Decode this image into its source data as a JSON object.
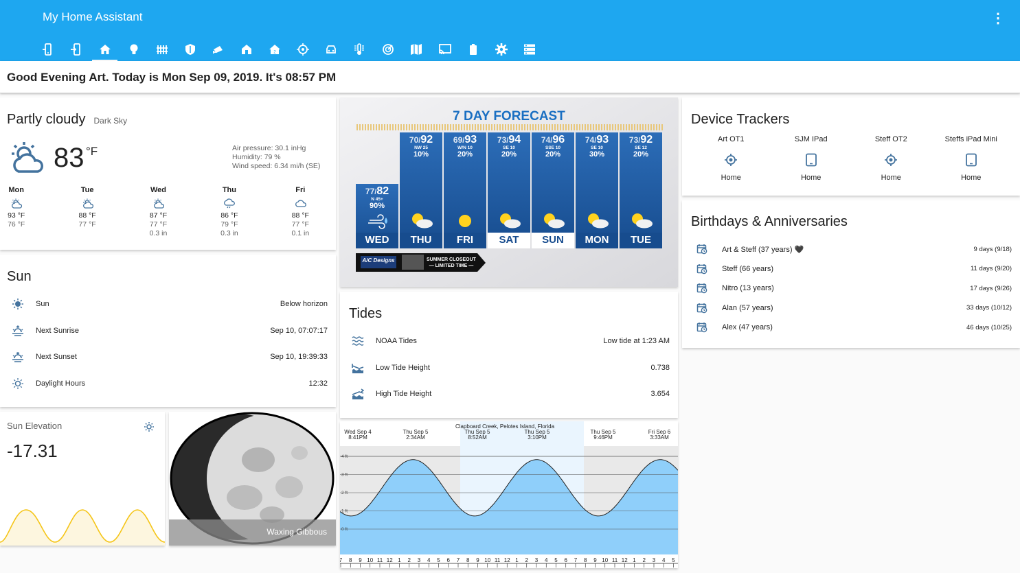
{
  "header": {
    "title": "My Home Assistant",
    "menu_icon": "dots-vertical-icon",
    "tabs": [
      "phone-icon",
      "phone-enter-icon",
      "home-icon",
      "bulb-icon",
      "fence-icon",
      "shield-icon",
      "cctv-icon",
      "home-modern-icon",
      "home-floor-icon",
      "crosshair-icon",
      "car-icon",
      "thermometer-icon",
      "radar-icon",
      "map-icon",
      "cast-icon",
      "battery-icon",
      "settings-icon",
      "server-icon"
    ],
    "active_tab": 2
  },
  "greeting": "Good Evening Art. Today is Mon Sep 09, 2019. It's 08:57 PM",
  "weather": {
    "condition": "Partly cloudy",
    "source": "Dark Sky",
    "temp": "83",
    "unit": "°F",
    "pressure": "Air pressure: 30.1 inHg",
    "humidity": "Humidity: 79 %",
    "wind": "Wind speed: 6.34 mi/h (SE)",
    "forecast": [
      {
        "day": "Mon",
        "icon": "partly-cloudy-icon",
        "high": "93 °F",
        "low": "76 °F",
        "precip": ""
      },
      {
        "day": "Tue",
        "icon": "partly-cloudy-icon",
        "high": "88 °F",
        "low": "77 °F",
        "precip": ""
      },
      {
        "day": "Wed",
        "icon": "partly-cloudy-icon",
        "high": "87 °F",
        "low": "77 °F",
        "precip": "0.3 in"
      },
      {
        "day": "Thu",
        "icon": "rain-icon",
        "high": "86 °F",
        "low": "79 °F",
        "precip": "0.3 in"
      },
      {
        "day": "Fri",
        "icon": "cloudy-icon",
        "high": "88 °F",
        "low": "77 °F",
        "precip": "0.1 in"
      }
    ]
  },
  "sun": {
    "title": "Sun",
    "rows": [
      {
        "icon": "sun-icon",
        "label": "Sun",
        "value": "Below horizon"
      },
      {
        "icon": "sunrise-icon",
        "label": "Next Sunrise",
        "value": "Sep 10, 07:07:17"
      },
      {
        "icon": "sunset-icon",
        "label": "Next Sunset",
        "value": "Sep 10, 19:39:33"
      },
      {
        "icon": "sun-outline-icon",
        "label": "Daylight Hours",
        "value": "12:32"
      }
    ]
  },
  "sun_elevation": {
    "title": "Sun Elevation",
    "value": "-17.31",
    "color": "#f5c518"
  },
  "moon": {
    "phase": "Waxing Gibbous"
  },
  "forecast_image": {
    "title": "7 DAY FORECAST",
    "sponsor": "A/C Designs",
    "promo_line1": "SUMMER CLOSEOUT",
    "promo_line2": "— LIMITED TIME —",
    "days": [
      {
        "day": "WED",
        "lo": "77",
        "hi": "82",
        "wind": "N 45+",
        "pop": "90%",
        "highlight": false
      },
      {
        "day": "THU",
        "lo": "70",
        "hi": "92",
        "wind": "NW 25",
        "pop": "10%",
        "highlight": false
      },
      {
        "day": "FRI",
        "lo": "69",
        "hi": "93",
        "wind": "W/N 10",
        "pop": "20%",
        "highlight": false
      },
      {
        "day": "SAT",
        "lo": "73",
        "hi": "94",
        "wind": "SE 10",
        "pop": "20%",
        "highlight": true
      },
      {
        "day": "SUN",
        "lo": "74",
        "hi": "96",
        "wind": "SSE 10",
        "pop": "20%",
        "highlight": true
      },
      {
        "day": "MON",
        "lo": "74",
        "hi": "93",
        "wind": "SE 10",
        "pop": "30%",
        "highlight": false
      },
      {
        "day": "TUE",
        "lo": "73",
        "hi": "92",
        "wind": "SE 12",
        "pop": "20%",
        "highlight": false
      }
    ]
  },
  "tides": {
    "title": "Tides",
    "rows": [
      {
        "icon": "waves-icon",
        "label": "NOAA Tides",
        "value": "Low tide at 1:23 AM"
      },
      {
        "icon": "tide-low-icon",
        "label": "Low Tide Height",
        "value": "0.738"
      },
      {
        "icon": "tide-high-icon",
        "label": "High Tide Height",
        "value": "3.654"
      }
    ]
  },
  "tide_chart": {
    "location": "Clapboard Creek, Pelotes Island, Florida",
    "events": [
      {
        "date": "Wed Sep  4",
        "time": "8:41PM"
      },
      {
        "date": "Thu Sep  5",
        "time": "2:34AM"
      },
      {
        "date": "Thu Sep  5",
        "time": "8:52AM"
      },
      {
        "date": "Thu Sep  5",
        "time": "3:10PM"
      },
      {
        "date": "Thu Sep  5",
        "time": "9:46PM"
      },
      {
        "date": "Fri Sep  6",
        "time": "3:33AM"
      }
    ],
    "yticks": [
      "4 ft",
      "3 ft",
      "2 ft",
      "1 ft",
      "0 ft"
    ],
    "xticks": [
      "7",
      "8",
      "9",
      "10",
      "11",
      "12",
      "1",
      "2",
      "3",
      "4",
      "5",
      "6",
      "7",
      "8",
      "9",
      "10",
      "11",
      "12",
      "1",
      "2",
      "3",
      "4",
      "5",
      "6",
      "7",
      "8",
      "9",
      "10",
      "11",
      "12",
      "1",
      "2",
      "3",
      "4",
      "5"
    ]
  },
  "devices": {
    "title": "Device Trackers",
    "items": [
      {
        "name": "Art OT1",
        "icon": "crosshairs-gps-icon",
        "state": "Home"
      },
      {
        "name": "SJM IPad",
        "icon": "tablet-icon",
        "state": "Home"
      },
      {
        "name": "Steff OT2",
        "icon": "crosshairs-gps-icon",
        "state": "Home"
      },
      {
        "name": "Steffs iPad Mini",
        "icon": "tablet-icon",
        "state": "Home"
      }
    ]
  },
  "birthdays": {
    "title": "Birthdays & Anniversaries",
    "items": [
      {
        "label": "Art & Steff (37 years) 🖤",
        "when": "9 days (9/18)"
      },
      {
        "label": "Steff (66 years)",
        "when": "11 days (9/20)"
      },
      {
        "label": "Nitro (13 years)",
        "when": "17 days (9/26)"
      },
      {
        "label": "Alan (57 years)",
        "when": "33 days (10/12)"
      },
      {
        "label": "Alex (47 years)",
        "when": "46 days (10/25)"
      }
    ]
  }
}
